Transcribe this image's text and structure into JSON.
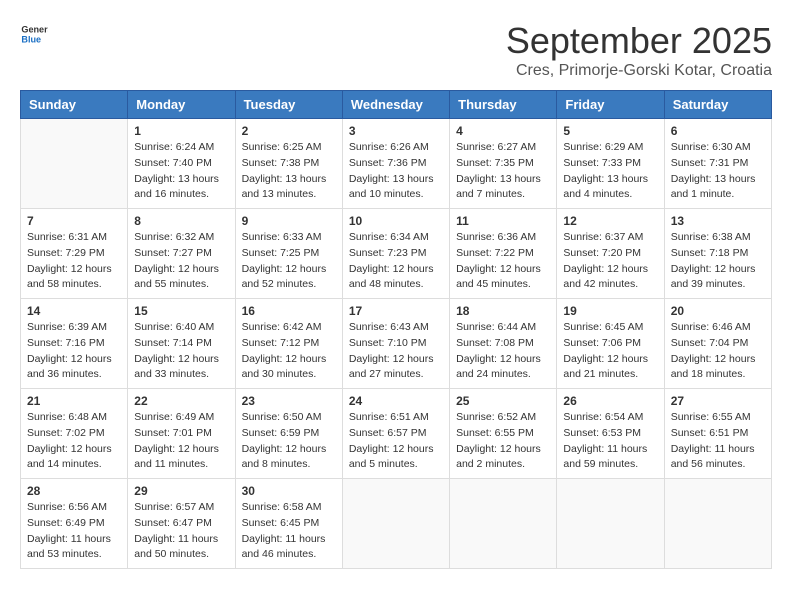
{
  "logo": {
    "general": "General",
    "blue": "Blue"
  },
  "title": "September 2025",
  "location": "Cres, Primorje-Gorski Kotar, Croatia",
  "weekdays": [
    "Sunday",
    "Monday",
    "Tuesday",
    "Wednesday",
    "Thursday",
    "Friday",
    "Saturday"
  ],
  "weeks": [
    [
      {
        "day": "",
        "info": ""
      },
      {
        "day": "1",
        "info": "Sunrise: 6:24 AM\nSunset: 7:40 PM\nDaylight: 13 hours\nand 16 minutes."
      },
      {
        "day": "2",
        "info": "Sunrise: 6:25 AM\nSunset: 7:38 PM\nDaylight: 13 hours\nand 13 minutes."
      },
      {
        "day": "3",
        "info": "Sunrise: 6:26 AM\nSunset: 7:36 PM\nDaylight: 13 hours\nand 10 minutes."
      },
      {
        "day": "4",
        "info": "Sunrise: 6:27 AM\nSunset: 7:35 PM\nDaylight: 13 hours\nand 7 minutes."
      },
      {
        "day": "5",
        "info": "Sunrise: 6:29 AM\nSunset: 7:33 PM\nDaylight: 13 hours\nand 4 minutes."
      },
      {
        "day": "6",
        "info": "Sunrise: 6:30 AM\nSunset: 7:31 PM\nDaylight: 13 hours\nand 1 minute."
      }
    ],
    [
      {
        "day": "7",
        "info": "Sunrise: 6:31 AM\nSunset: 7:29 PM\nDaylight: 12 hours\nand 58 minutes."
      },
      {
        "day": "8",
        "info": "Sunrise: 6:32 AM\nSunset: 7:27 PM\nDaylight: 12 hours\nand 55 minutes."
      },
      {
        "day": "9",
        "info": "Sunrise: 6:33 AM\nSunset: 7:25 PM\nDaylight: 12 hours\nand 52 minutes."
      },
      {
        "day": "10",
        "info": "Sunrise: 6:34 AM\nSunset: 7:23 PM\nDaylight: 12 hours\nand 48 minutes."
      },
      {
        "day": "11",
        "info": "Sunrise: 6:36 AM\nSunset: 7:22 PM\nDaylight: 12 hours\nand 45 minutes."
      },
      {
        "day": "12",
        "info": "Sunrise: 6:37 AM\nSunset: 7:20 PM\nDaylight: 12 hours\nand 42 minutes."
      },
      {
        "day": "13",
        "info": "Sunrise: 6:38 AM\nSunset: 7:18 PM\nDaylight: 12 hours\nand 39 minutes."
      }
    ],
    [
      {
        "day": "14",
        "info": "Sunrise: 6:39 AM\nSunset: 7:16 PM\nDaylight: 12 hours\nand 36 minutes."
      },
      {
        "day": "15",
        "info": "Sunrise: 6:40 AM\nSunset: 7:14 PM\nDaylight: 12 hours\nand 33 minutes."
      },
      {
        "day": "16",
        "info": "Sunrise: 6:42 AM\nSunset: 7:12 PM\nDaylight: 12 hours\nand 30 minutes."
      },
      {
        "day": "17",
        "info": "Sunrise: 6:43 AM\nSunset: 7:10 PM\nDaylight: 12 hours\nand 27 minutes."
      },
      {
        "day": "18",
        "info": "Sunrise: 6:44 AM\nSunset: 7:08 PM\nDaylight: 12 hours\nand 24 minutes."
      },
      {
        "day": "19",
        "info": "Sunrise: 6:45 AM\nSunset: 7:06 PM\nDaylight: 12 hours\nand 21 minutes."
      },
      {
        "day": "20",
        "info": "Sunrise: 6:46 AM\nSunset: 7:04 PM\nDaylight: 12 hours\nand 18 minutes."
      }
    ],
    [
      {
        "day": "21",
        "info": "Sunrise: 6:48 AM\nSunset: 7:02 PM\nDaylight: 12 hours\nand 14 minutes."
      },
      {
        "day": "22",
        "info": "Sunrise: 6:49 AM\nSunset: 7:01 PM\nDaylight: 12 hours\nand 11 minutes."
      },
      {
        "day": "23",
        "info": "Sunrise: 6:50 AM\nSunset: 6:59 PM\nDaylight: 12 hours\nand 8 minutes."
      },
      {
        "day": "24",
        "info": "Sunrise: 6:51 AM\nSunset: 6:57 PM\nDaylight: 12 hours\nand 5 minutes."
      },
      {
        "day": "25",
        "info": "Sunrise: 6:52 AM\nSunset: 6:55 PM\nDaylight: 12 hours\nand 2 minutes."
      },
      {
        "day": "26",
        "info": "Sunrise: 6:54 AM\nSunset: 6:53 PM\nDaylight: 11 hours\nand 59 minutes."
      },
      {
        "day": "27",
        "info": "Sunrise: 6:55 AM\nSunset: 6:51 PM\nDaylight: 11 hours\nand 56 minutes."
      }
    ],
    [
      {
        "day": "28",
        "info": "Sunrise: 6:56 AM\nSunset: 6:49 PM\nDaylight: 11 hours\nand 53 minutes."
      },
      {
        "day": "29",
        "info": "Sunrise: 6:57 AM\nSunset: 6:47 PM\nDaylight: 11 hours\nand 50 minutes."
      },
      {
        "day": "30",
        "info": "Sunrise: 6:58 AM\nSunset: 6:45 PM\nDaylight: 11 hours\nand 46 minutes."
      },
      {
        "day": "",
        "info": ""
      },
      {
        "day": "",
        "info": ""
      },
      {
        "day": "",
        "info": ""
      },
      {
        "day": "",
        "info": ""
      }
    ]
  ]
}
